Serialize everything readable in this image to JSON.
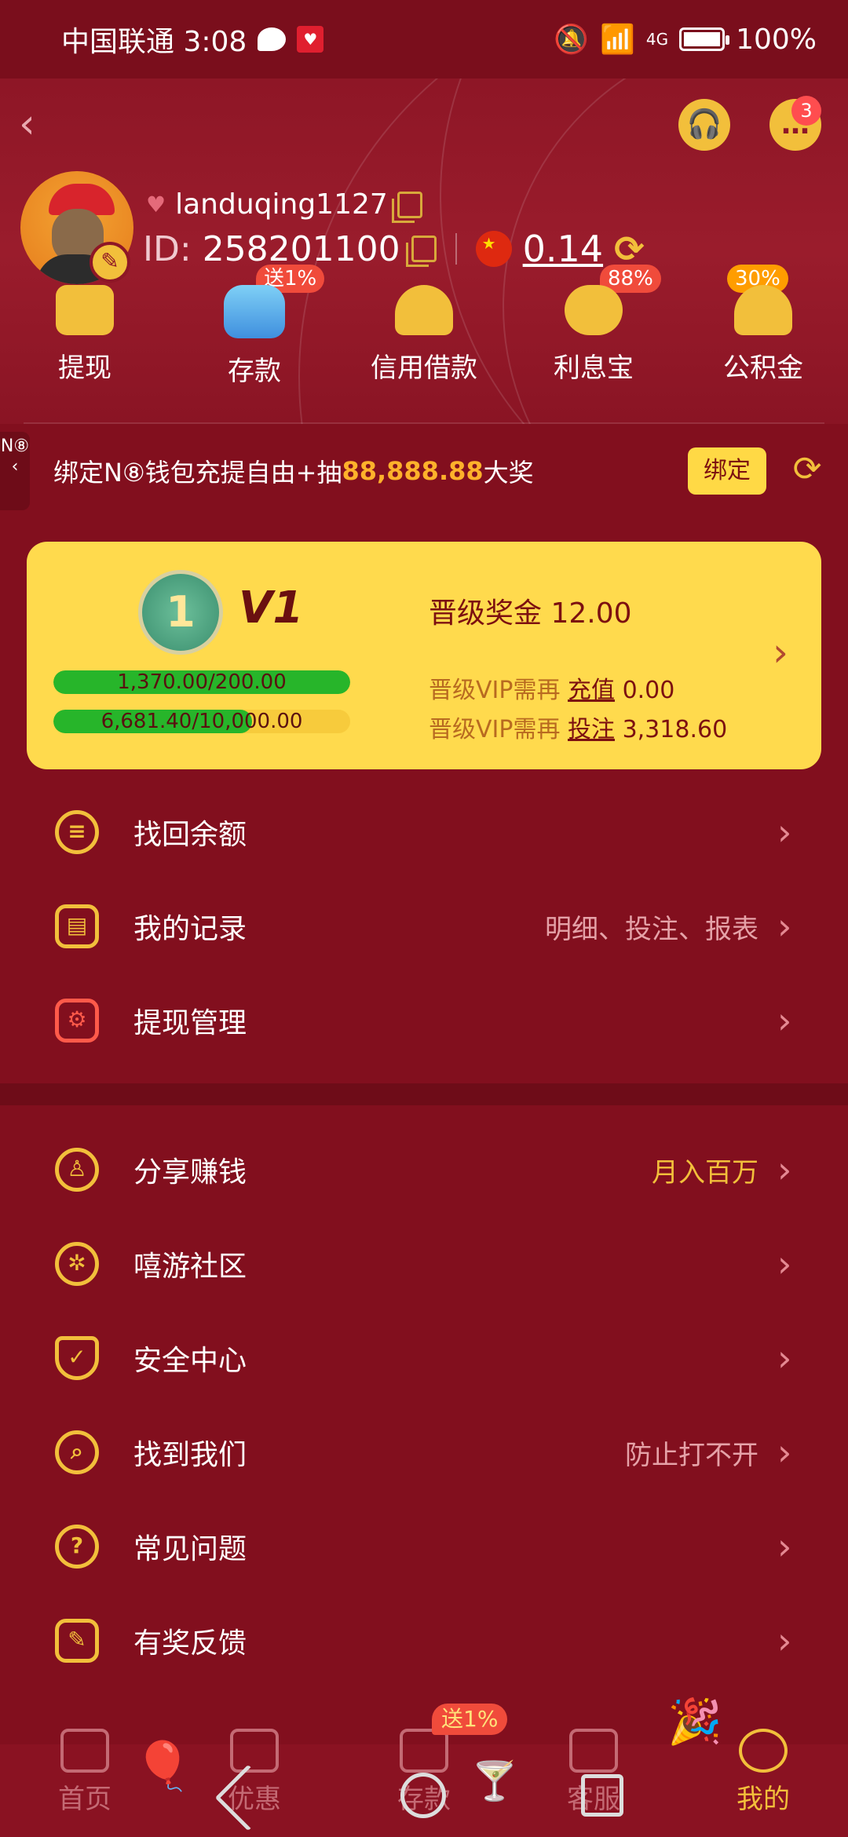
{
  "status_bar": {
    "carrier_time": "中国联通 3:08",
    "signal": "4G",
    "battery": "100%"
  },
  "header": {
    "username": "landuqing1127",
    "id_label": "ID:",
    "id_value": "258201100",
    "balance": "0.14",
    "support_icon": "headset-icon",
    "message_badge": "3"
  },
  "quick_actions": [
    {
      "label": "提现",
      "icon": "withdraw-icon",
      "badge": ""
    },
    {
      "label": "存款",
      "icon": "wallet-deposit-icon",
      "badge": "送1%"
    },
    {
      "label": "信用借款",
      "icon": "credit-loan-icon",
      "badge": ""
    },
    {
      "label": "利息宝",
      "icon": "piggy-bank-icon",
      "badge": "88%"
    },
    {
      "label": "公积金",
      "icon": "fund-hand-icon",
      "badge": "30%"
    }
  ],
  "side_tab": {
    "text": "N⑧"
  },
  "wallet_banner": {
    "prefix": "绑定N⑧钱包充提自由+抽",
    "amount": "88,888.88",
    "suffix": "大奖",
    "bind_label": "绑定"
  },
  "vip": {
    "medal_number": "1",
    "level": "V1",
    "progress1_text": "1,370.00/200.00",
    "progress1_fraction": 1.0,
    "progress2_text": "6,681.40/10,000.00",
    "progress2_fraction": 0.668,
    "bonus_label": "晋级奖金",
    "bonus_value": "12.00",
    "need_prefix": "晋级VIP需再",
    "need1_link": "充值",
    "need1_value": "0.00",
    "need2_link": "投注",
    "need2_value": "3,318.60"
  },
  "menu_group1": [
    {
      "label": "找回余额",
      "extra": "",
      "icon": "recover-balance-icon"
    },
    {
      "label": "我的记录",
      "extra": "明细、投注、报表",
      "icon": "records-icon"
    },
    {
      "label": "提现管理",
      "extra": "",
      "icon": "withdraw-manage-icon"
    }
  ],
  "menu_group2": [
    {
      "label": "分享赚钱",
      "extra": "月入百万",
      "icon": "share-user-icon"
    },
    {
      "label": "嘻游社区",
      "extra": "",
      "icon": "community-aperture-icon"
    },
    {
      "label": "安全中心",
      "extra": "",
      "icon": "shield-check-icon"
    },
    {
      "label": "找到我们",
      "extra": "防止打不开",
      "icon": "find-us-icon"
    },
    {
      "label": "常见问题",
      "extra": "",
      "icon": "help-circle-icon"
    },
    {
      "label": "有奖反馈",
      "extra": "",
      "icon": "feedback-edit-icon"
    }
  ],
  "bottom_nav": [
    {
      "label": "首页",
      "icon": "home-icon"
    },
    {
      "label": "优惠",
      "icon": "gift-icon"
    },
    {
      "label": "存款",
      "icon": "deposit-wallet-icon",
      "badge": "送1%"
    },
    {
      "label": "客服",
      "icon": "customer-service-icon"
    },
    {
      "label": "我的",
      "icon": "profile-icon"
    }
  ],
  "colors": {
    "background": "#820f1e",
    "gold": "#f2bf3b",
    "vip_card": "#ffda4d",
    "progress_green": "#27b52a"
  }
}
